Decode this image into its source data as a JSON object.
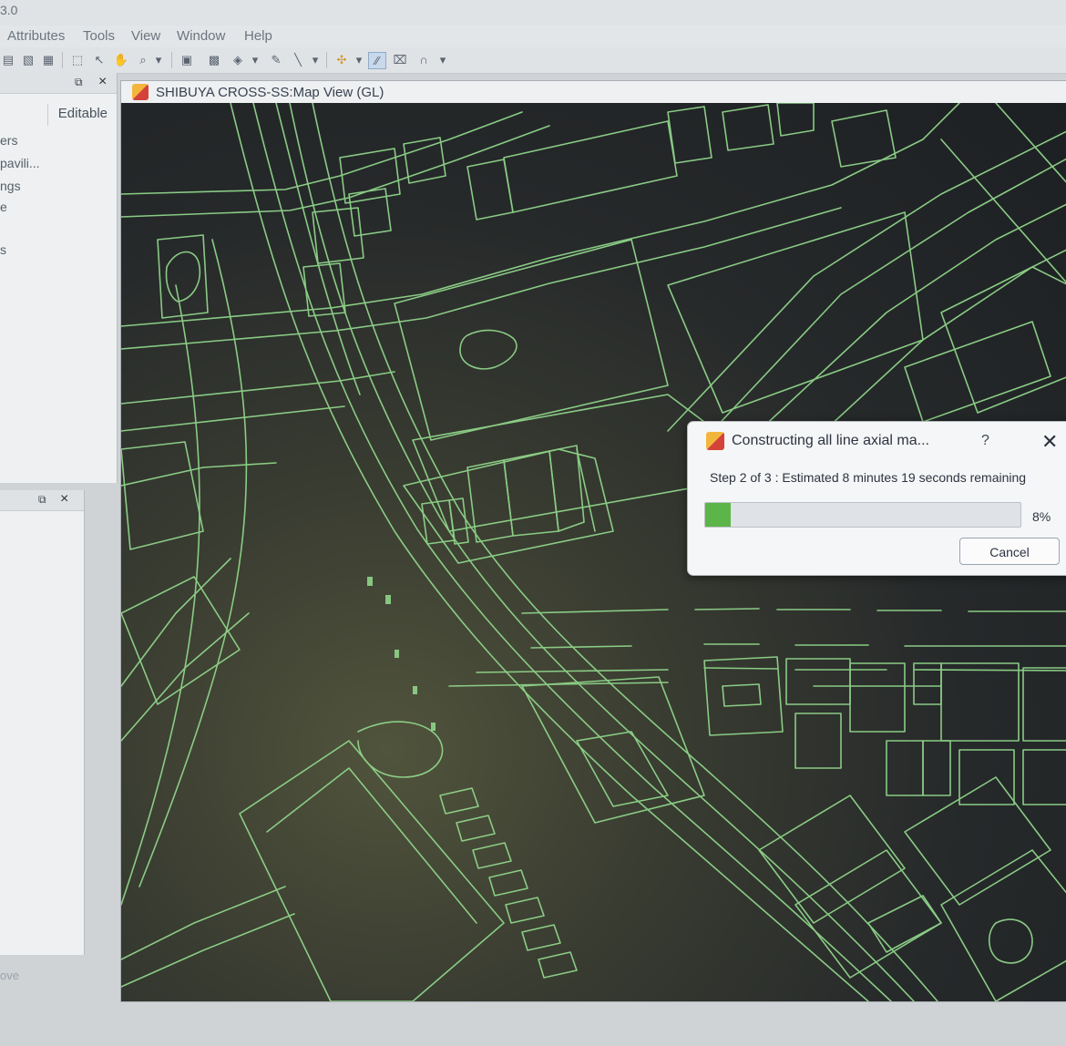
{
  "app": {
    "title_fragment": "3.0"
  },
  "menu": [
    "Attributes",
    "Tools",
    "View",
    "Window",
    "Help"
  ],
  "toolbar": {
    "icons": [
      "layer-add-icon",
      "layer-remove-icon",
      "attribute-table-icon",
      "select-icon",
      "pointer-icon",
      "hand-pan-icon",
      "zoom-icon",
      "zoom-dropdown-icon",
      "grid-icon",
      "fill-grid-icon",
      "fill-bucket-icon",
      "fill-dropdown-icon",
      "pencil-icon",
      "line-tool-icon",
      "line-dropdown-icon",
      "join-icon",
      "join-dropdown-icon",
      "axial-line-icon",
      "unlink-icon",
      "link-icon",
      "link-dropdown-icon"
    ]
  },
  "left_panel_top": {
    "column_header": "Editable",
    "items": [
      "ers",
      "pavili...",
      "ngs",
      "e",
      "s"
    ]
  },
  "left_panel_bottom": {
    "bottom_label": "ove"
  },
  "map_window": {
    "title": "SHIBUYA CROSS-SS:Map View (GL)"
  },
  "dialog": {
    "title": "Constructing all line axial ma...",
    "help_label": "?",
    "close_label": "✕",
    "status": "Step 2 of 3 : Estimated 8 minutes 19 seconds remaining",
    "progress_fraction": 0.08,
    "progress_label": "8%",
    "cancel_label": "Cancel"
  },
  "colors": {
    "map_line": "#8fd48a",
    "progress_fill": "#5cb548"
  }
}
